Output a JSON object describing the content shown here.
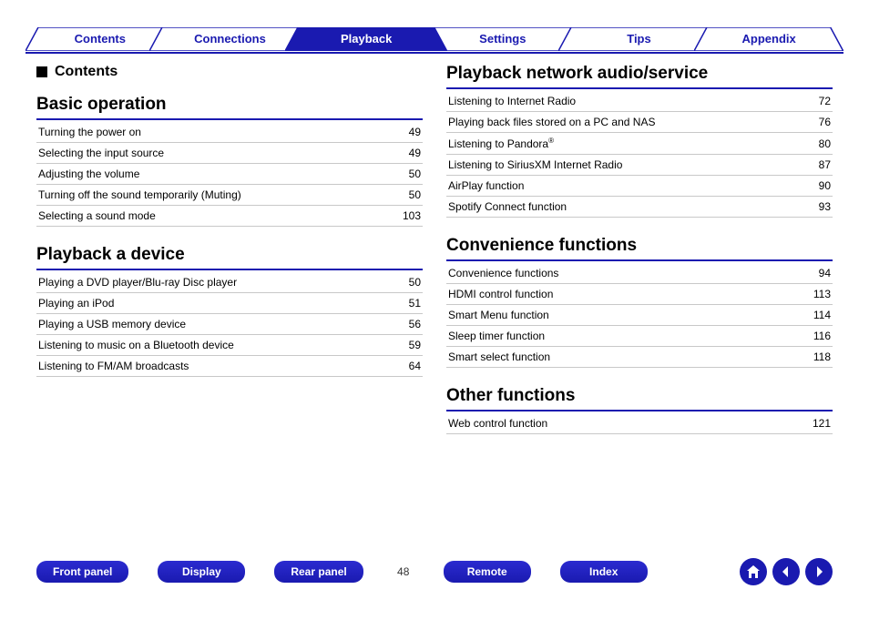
{
  "tabs": {
    "items": [
      "Contents",
      "Connections",
      "Playback",
      "Settings",
      "Tips",
      "Appendix"
    ],
    "active_index": 2
  },
  "contents_label": "Contents",
  "columns": {
    "left": [
      {
        "title": "Basic operation",
        "rows": [
          {
            "label": "Turning the power on",
            "page": "49"
          },
          {
            "label": "Selecting the input source",
            "page": "49"
          },
          {
            "label": "Adjusting the volume",
            "page": "50"
          },
          {
            "label": "Turning off the sound temporarily (Muting)",
            "page": "50"
          },
          {
            "label": "Selecting a sound mode",
            "page": "103"
          }
        ]
      },
      {
        "title": "Playback a device",
        "rows": [
          {
            "label": "Playing a DVD player/Blu-ray Disc player",
            "page": "50"
          },
          {
            "label": "Playing an iPod",
            "page": "51"
          },
          {
            "label": "Playing a USB memory device",
            "page": "56"
          },
          {
            "label": "Listening to music on a Bluetooth device",
            "page": "59"
          },
          {
            "label": "Listening to FM/AM broadcasts",
            "page": "64"
          }
        ]
      }
    ],
    "right": [
      {
        "title": "Playback network audio/service",
        "rows": [
          {
            "label": "Listening to Internet Radio",
            "page": "72"
          },
          {
            "label": "Playing back files stored on a PC and NAS",
            "page": "76"
          },
          {
            "label": "Listening to Pandora®",
            "page": "80",
            "has_reg": true
          },
          {
            "label": "Listening to SiriusXM Internet Radio",
            "page": "87"
          },
          {
            "label": "AirPlay function",
            "page": "90"
          },
          {
            "label": "Spotify Connect function",
            "page": "93"
          }
        ]
      },
      {
        "title": "Convenience functions",
        "rows": [
          {
            "label": "Convenience functions",
            "page": "94"
          },
          {
            "label": "HDMI control function",
            "page": "113"
          },
          {
            "label": "Smart Menu function",
            "page": "114"
          },
          {
            "label": "Sleep timer function",
            "page": "116"
          },
          {
            "label": "Smart select function",
            "page": "118"
          }
        ]
      },
      {
        "title": "Other functions",
        "rows": [
          {
            "label": "Web control function",
            "page": "121"
          }
        ]
      }
    ]
  },
  "footer": {
    "buttons": [
      "Front panel",
      "Display",
      "Rear panel",
      "Remote",
      "Index"
    ],
    "page_number": "48"
  }
}
